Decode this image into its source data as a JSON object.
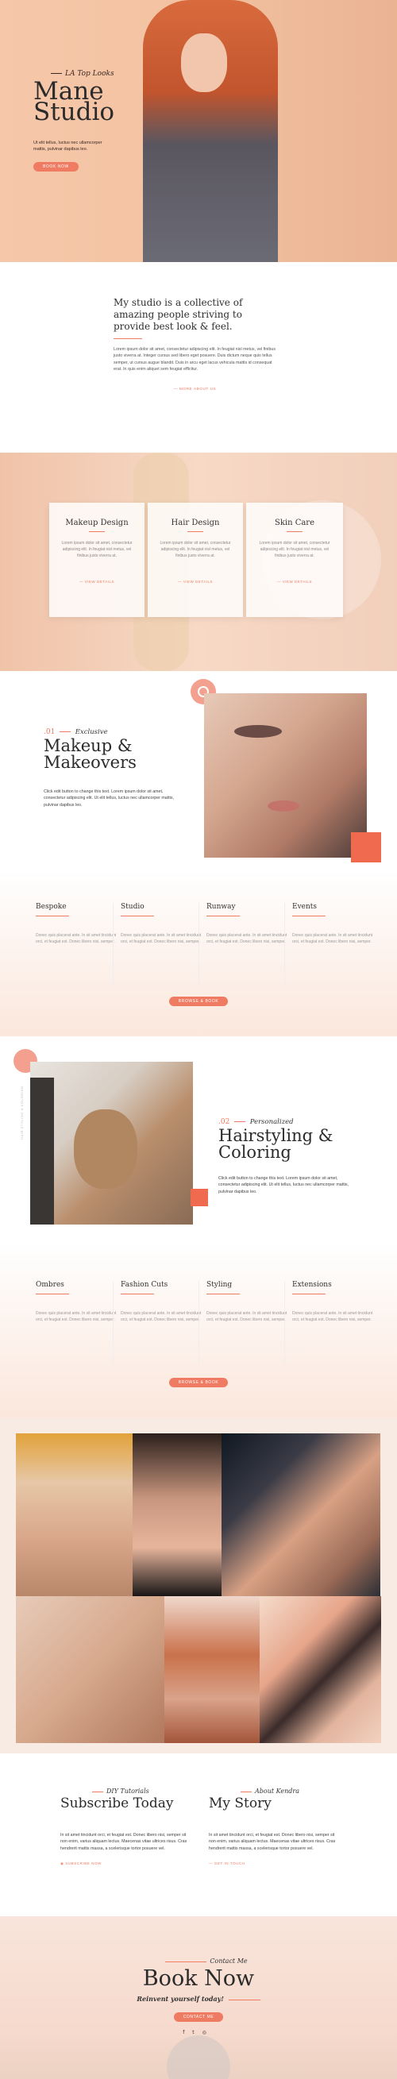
{
  "hero": {
    "script": "LA Top Looks",
    "title_line1": "Mane",
    "title_line2": "Studio",
    "text": "Ut elit tellus, luctus nec ullamcorper mattis, pulvinar dapibus leo.",
    "button": "BOOK NOW"
  },
  "intro": {
    "heading": "My studio is a collective of amazing people striving to provide best look & feel.",
    "body": "Lorem ipsum dolor sit amet, consectetur adipiscing elit. In feugiat nisl metus, vel finibus justo viverra at. Integer cursus sed libero eget posuere. Duis dictum neque quis tellus semper, ut cursus augue blandit. Duis in arcu eget lacus vehicula mattis id consequat erat. In quis enim aliquet sem feugiat efficitur.",
    "link": "— MORE ABOUT US"
  },
  "services": [
    {
      "title": "Makeup Design",
      "text": "Lorem ipsum dolor sit amet, consectetur adipiscing elit. In feugiat nisl metus, vel finibus justo viverra at.",
      "link": "— VIEW DETAILS"
    },
    {
      "title": "Hair Design",
      "text": "Lorem ipsum dolor sit amet, consectetur adipiscing elit. In feugiat nisl metus, vel finibus justo viverra at.",
      "link": "— VIEW DETAILS"
    },
    {
      "title": "Skin Care",
      "text": "Lorem ipsum dolor sit amet, consectetur adipiscing elit. In feugiat nisl metus, vel finibus justo viverra at.",
      "link": "— VIEW DETAILS"
    }
  ],
  "makeup": {
    "number": ".01",
    "script": "Exclusive",
    "title_line1": "Makeup &",
    "title_line2": "Makeovers",
    "text": "Click edit button to change this text. Lorem ipsum dolor sit amet, consectetur adipiscing elit. Ut elit tellus, luctus nec ullamcorper mattis, pulvinar dapibus leo."
  },
  "makeup_styles": [
    {
      "title": "Bespoke",
      "text": "Donec quis placerat ante. In sit amet tincidunt orci, et feugiat est. Donec libero nisi, semper."
    },
    {
      "title": "Studio",
      "text": "Donec quis placerat ante. In sit amet tincidunt orci, et feugiat est. Donec libero nisi, semper."
    },
    {
      "title": "Runway",
      "text": "Donec quis placerat ante. In sit amet tincidunt orci, et feugiat est. Donec libero nisi, semper."
    },
    {
      "title": "Events",
      "text": "Donec quis placerat ante. In sit amet tincidunt orci, et feugiat est. Donec libero nisi, semper."
    }
  ],
  "makeup_button": "BROWSE & BOOK",
  "hair": {
    "number": ".02",
    "script": "Personalized",
    "title_line1": "Hairstyling &",
    "title_line2": "Coloring",
    "text": "Click edit button to change this text. Lorem ipsum dolor sit amet, consectetur adipiscing elit. Ut elit tellus, luctus nec ullamcorper mattis, pulvinar dapibus leo.",
    "vertical": "HAIR STYLING & COLORING"
  },
  "hair_styles": [
    {
      "title": "Ombres",
      "text": "Donec quis placerat ante. In sit amet tincidunt orci, et feugiat est. Donec libero nisi, semper."
    },
    {
      "title": "Fashion Cuts",
      "text": "Donec quis placerat ante. In sit amet tincidunt orci, et feugiat est. Donec libero nisi, semper."
    },
    {
      "title": "Styling",
      "text": "Donec quis placerat ante. In sit amet tincidunt orci, et feugiat est. Donec libero nisi, semper."
    },
    {
      "title": "Extensions",
      "text": "Donec quis placerat ante. In sit amet tincidunt orci, et feugiat est. Donec libero nisi, semper."
    }
  ],
  "hair_button": "BROWSE & BOOK",
  "tutorials": {
    "script": "DIY Tutorials",
    "title": "Subscribe Today",
    "text": "In sit amet tincidunt orci, et feugiat est. Donec libero nisi, semper sit non enim, varius aliquam lectus. Maecenas vitae ultrices risus. Cras hendrerit mattis massa, a scelerisque tortor posuere vel.",
    "link": "SUBSCRIBE NOW"
  },
  "about": {
    "script": "About Kendra",
    "title": "My Story",
    "text": "In sit amet tincidunt orci, et feugiat est. Donec libero nisi, semper sit non enim, varius aliquam lectus. Maecenas vitae ultrices risus. Cras hendrerit mattis massa, a scelerisque tortor posuere vel.",
    "link": "GET IN TOUCH"
  },
  "book": {
    "script": "Contact Me",
    "title": "Book Now",
    "tagline": "Reinvent yourself today!",
    "button": "CONTACT ME"
  },
  "social": [
    "f",
    "t",
    "◎"
  ],
  "colors": {
    "accent": "#ef7b62",
    "peach": "#f6c7a9"
  }
}
